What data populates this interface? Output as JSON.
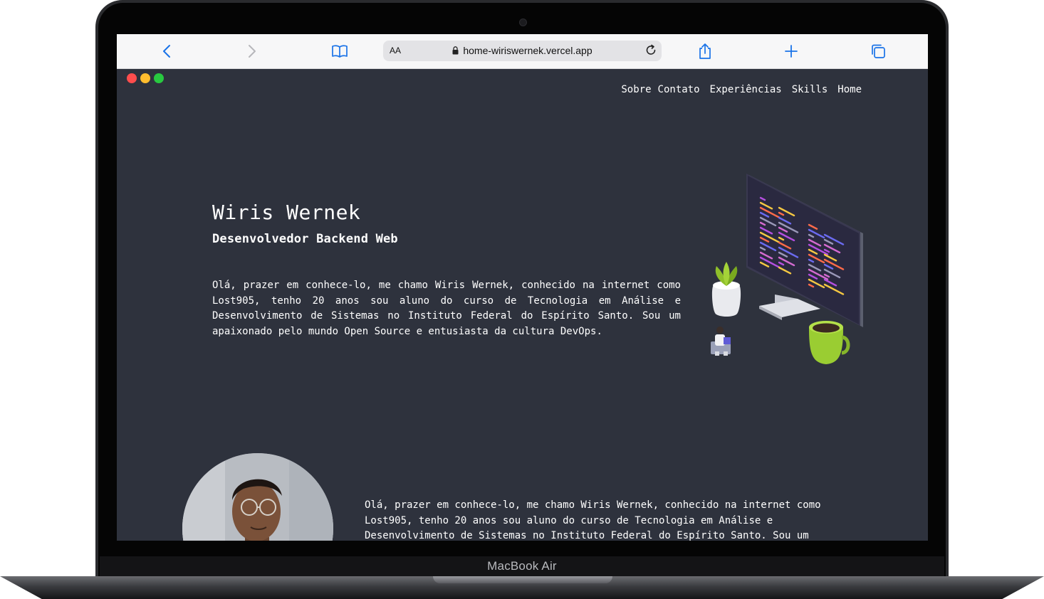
{
  "device": {
    "label": "MacBook Air"
  },
  "browser": {
    "url": "home-wiriswernek.vercel.app",
    "aa_label": "AA",
    "icons": [
      "back-icon",
      "forward-icon",
      "bookmarks-icon",
      "lock-icon",
      "reload-icon",
      "share-icon",
      "new-tab-icon",
      "tabs-icon"
    ]
  },
  "window_dots": {
    "colors": [
      "#ff4d4d",
      "#ffbd2e",
      "#28c940"
    ]
  },
  "nav": {
    "items": [
      "Sobre",
      "Contato",
      "Experiências",
      "Skills",
      "Home"
    ]
  },
  "hero": {
    "name": "Wiris Wernek",
    "role": "Desenvolvedor Backend Web",
    "intro": "Olá, prazer em conhece-lo, me chamo Wiris Wernek, conhecido na internet como Lost905, tenho 20 anos sou aluno do curso de Tecnologia em Análise e Desenvolvimento de Sistemas no Instituto Federal do Espírito Santo. Sou um apaixonado pelo mundo Open Source e entusiasta da cultura DevOps."
  },
  "about": {
    "text": "Olá, prazer em conhece-lo, me chamo Wiris Wernek, conhecido na internet como Lost905, tenho 20 anos sou aluno do curso de Tecnologia em Análise e Desenvolvimento de Sistemas no Instituto Federal do Espírito Santo. Sou um"
  },
  "colors": {
    "page_bg": "#2e323d",
    "accent_green": "#9acd32",
    "code_purple": "#b44fe0",
    "code_yellow": "#f5c842"
  }
}
